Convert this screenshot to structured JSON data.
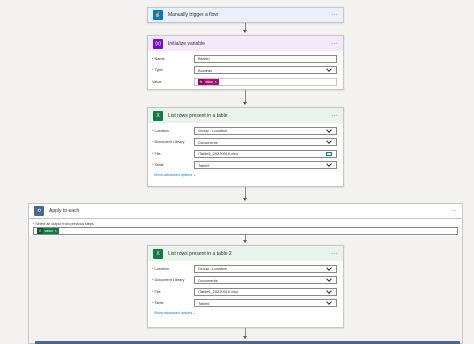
{
  "trigger": {
    "title": "Manually trigger a flow",
    "more": "···"
  },
  "init_var": {
    "title": "Initialize variable",
    "more": "···",
    "fields": [
      {
        "label": "Name",
        "required": true,
        "value": "fMatch"
      },
      {
        "label": "Type",
        "required": true,
        "value": "Boolean"
      },
      {
        "label": "Value",
        "required": false,
        "value": ""
      }
    ],
    "value_token": "false"
  },
  "list_rows_1": {
    "title": "List rows present in a table",
    "more": "···",
    "fields": [
      {
        "label": "Location",
        "required": true,
        "value": "Group - Location"
      },
      {
        "label": "Document Library",
        "required": true,
        "value": "Documents"
      },
      {
        "label": "File",
        "required": true,
        "value": "/Table5_20220910.xlsx"
      },
      {
        "label": "Table",
        "required": true,
        "value": "Table5"
      }
    ],
    "advanced": "Show advanced options ⌄"
  },
  "apply_each": {
    "title": "Apply to each",
    "more": "···",
    "select_label": "* Select an output from previous steps",
    "token": "value"
  },
  "list_rows_2": {
    "title": "List rows present in a table 2",
    "more": "···",
    "fields": [
      {
        "label": "Location",
        "required": true,
        "value": "Group - Location"
      },
      {
        "label": "Document Library",
        "required": true,
        "value": "Documents"
      },
      {
        "label": "File",
        "required": true,
        "value": "/Table6_20220910.xlsx"
      },
      {
        "label": "Table",
        "required": true,
        "value": "Table6"
      }
    ],
    "advanced": "Show advanced options ⌄"
  },
  "colors": {
    "trigger": "#0078d4",
    "trigger_bg": "#e8f1fb",
    "variable": "#770bd6",
    "variable_bg": "#f3e9fb",
    "excel": "#107c41",
    "excel_bg": "#e8f3ec",
    "loop": "#486991",
    "token_pink": "#ad0b78"
  }
}
